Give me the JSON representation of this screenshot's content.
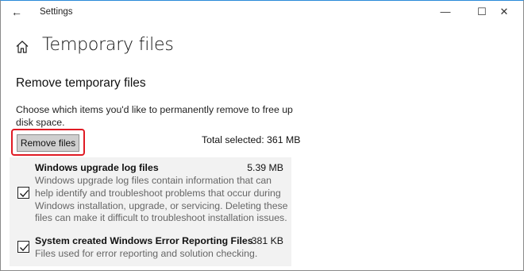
{
  "window": {
    "title": "Settings",
    "back_glyph": "←",
    "min_glyph": "—",
    "max_glyph": "☐",
    "close_glyph": "✕"
  },
  "page": {
    "title": "Temporary files",
    "home_icon": "home-icon"
  },
  "section": {
    "heading": "Remove temporary files",
    "description": "Choose which items you'd like to permanently remove to free up disk space.",
    "remove_button_label": "Remove files",
    "total_selected": "Total selected: 361 MB"
  },
  "items": [
    {
      "name": "Windows upgrade log files",
      "size": "5.39 MB",
      "checked": true,
      "description": "Windows upgrade log files contain information that can help identify and troubleshoot problems that occur during Windows installation, upgrade, or servicing.  Deleting these files can make it difficult to troubleshoot installation issues."
    },
    {
      "name": "System created Windows Error Reporting Files",
      "size": "381 KB",
      "checked": true,
      "description": "Files used for error reporting and solution checking."
    }
  ],
  "colors": {
    "highlight": "#e01b24",
    "list_background": "#f2f2f2",
    "button_background": "#cfcfcf"
  }
}
